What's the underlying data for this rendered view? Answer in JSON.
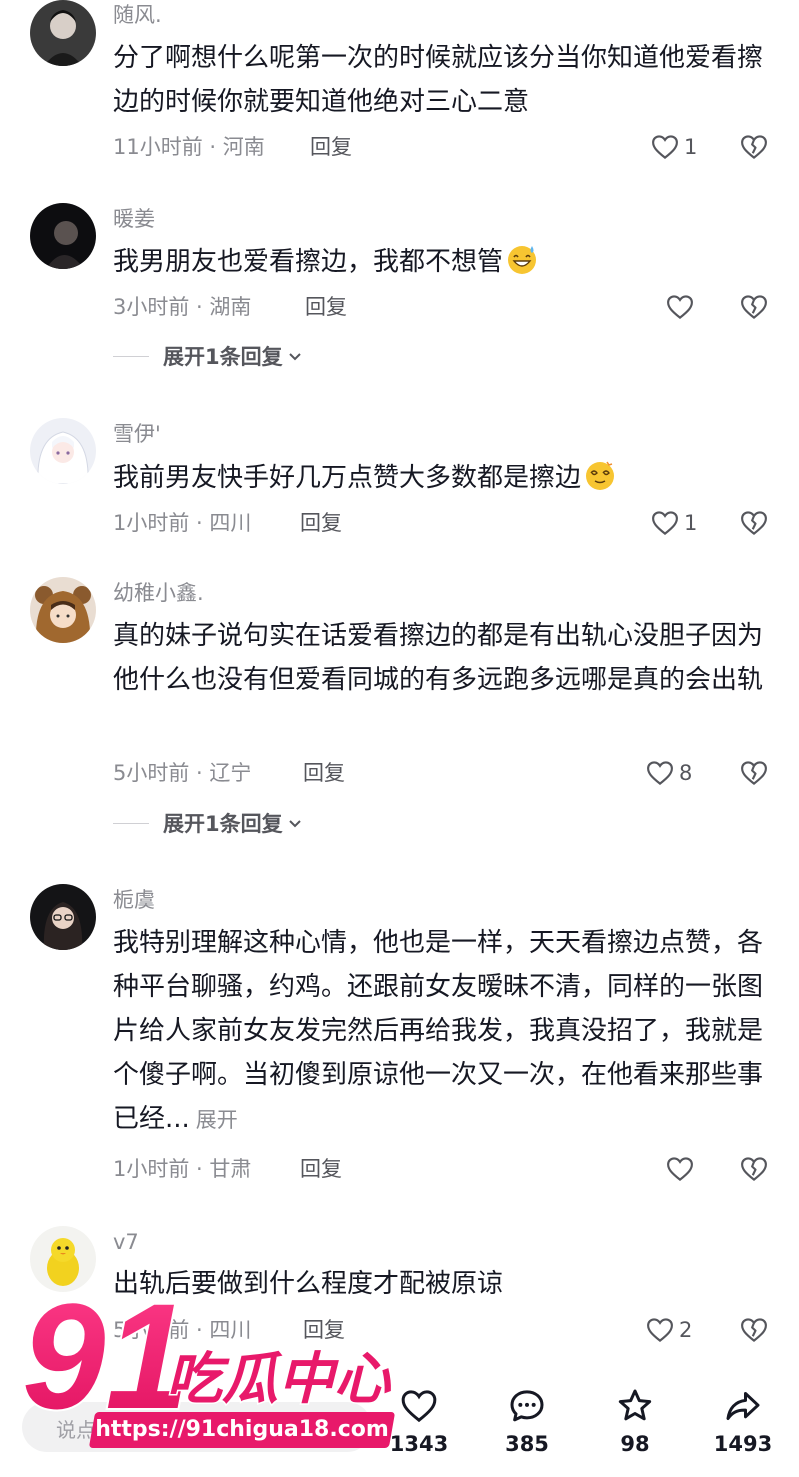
{
  "comments": [
    {
      "username": "随风.",
      "text": "分了啊想什么呢第一次的时候就应该分当你知道他爱看擦边的时候你就要知道他绝对三心二意",
      "meta": "11小时前 · 河南",
      "reply_label": "回复",
      "likes": "1",
      "avatar_icon": "avatar-dark-portrait"
    },
    {
      "username": "暖姜",
      "text": "我男朋友也爱看擦边，我都不想管",
      "emoji": "grinning-sweat-emoji",
      "meta": "3小时前 · 湖南",
      "reply_label": "回复",
      "likes": "",
      "expand_label": "展开1条回复",
      "avatar_icon": "avatar-dark-silhouette"
    },
    {
      "username": "雪伊'",
      "text": "我前男友快手好几万点赞大多数都是擦边",
      "emoji": "dizzy-face-emoji",
      "meta": "1小时前 · 四川",
      "reply_label": "回复",
      "likes": "1",
      "avatar_icon": "avatar-white-hair-anime"
    },
    {
      "username": "幼稚小鑫.",
      "text": "真的妹子说句实在话爱看擦边的都是有出轨心没胆子因为他什么也没有但爱看同城的有多远跑多远哪是真的会出轨",
      "meta": "5小时前 · 辽宁",
      "reply_label": "回复",
      "likes": "8",
      "expand_label": "展开1条回复",
      "avatar_icon": "avatar-bear-hood"
    },
    {
      "username": "栀虞",
      "text": "我特别理解这种心情，他也是一样，天天看擦边点赞，各种平台聊骚，约鸡。还跟前女友暧昧不清，同样的一张图片给人家前女友发完然后再给我发，我真没招了，我就是个傻子啊。当初傻到原谅他一次又一次，在他看来那些事已经...",
      "more_label": "展开",
      "meta": "1小时前 · 甘肃",
      "reply_label": "回复",
      "likes": "",
      "avatar_icon": "avatar-glasses-girl"
    },
    {
      "username": "v7",
      "text": "出轨后要做到什么程度才配被原谅",
      "meta": "5小时前 · 四川",
      "reply_label": "回复",
      "likes": "2",
      "avatar_icon": "avatar-yellow-duck"
    }
  ],
  "bottom_bar": {
    "input_placeholder": "说点什么",
    "like_count": "1343",
    "comment_count": "385",
    "favorite_count": "98",
    "share_count": "1493"
  },
  "watermark": {
    "logo_text": "91吃瓜中心",
    "url": "https://91chigua18.com"
  },
  "colors": {
    "text": "#161823",
    "secondary": "#8a8b91",
    "watermark_pink": "#e8196a"
  }
}
